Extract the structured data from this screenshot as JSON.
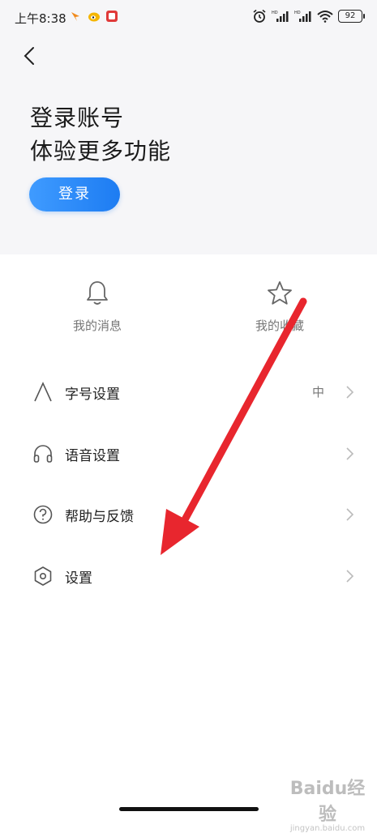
{
  "status_bar": {
    "time": "上午8:38",
    "battery": "92",
    "icons": [
      "notification-icon",
      "weibo-icon",
      "app-icon",
      "alarm-icon",
      "signal-icon",
      "wifi-icon",
      "battery-icon"
    ]
  },
  "header": {
    "back_icon": "chevron-left-icon",
    "line1": "登录账号",
    "line2": "体验更多功能",
    "login_button": "登录"
  },
  "quick_actions": [
    {
      "label": "我的消息",
      "icon": "bell-icon"
    },
    {
      "label": "我的收藏",
      "icon": "star-icon"
    }
  ],
  "menu": [
    {
      "label": "字号设置",
      "value": "中",
      "icon": "font-icon"
    },
    {
      "label": "语音设置",
      "value": "",
      "icon": "headphones-icon"
    },
    {
      "label": "帮助与反馈",
      "value": "",
      "icon": "help-icon"
    },
    {
      "label": "设置",
      "value": "",
      "icon": "settings-hexagon-icon"
    }
  ],
  "watermark": {
    "brand": "Baidu经验",
    "url": "jingyan.baidu.com"
  },
  "colors": {
    "accent": "#1d7cf2",
    "arrow": "#e8262e",
    "header_bg": "#f6f6f8"
  }
}
